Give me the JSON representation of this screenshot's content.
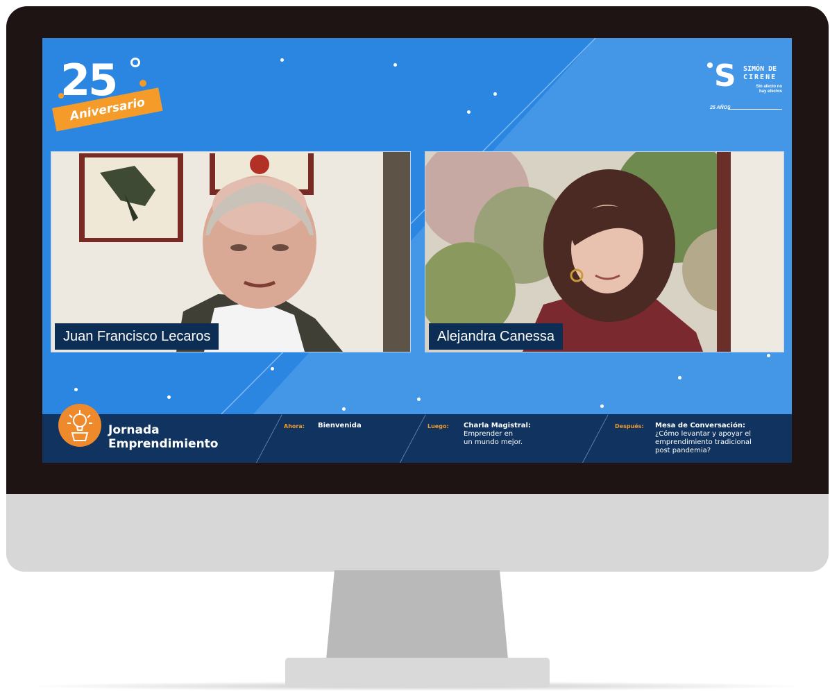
{
  "logo": {
    "number": "25",
    "ribbon": "Aniversario"
  },
  "brand": {
    "initial": "S",
    "name_line1": "SIMÓN DE",
    "name_line2": "CIRENE",
    "tagline_line1": "Sin afecto no",
    "tagline_line2": "hay efectos",
    "years": "25 AÑOS"
  },
  "participants": [
    {
      "name": "Juan Francisco Lecaros"
    },
    {
      "name": "Alejandra Canessa"
    }
  ],
  "event": {
    "title_line1": "Jornada",
    "title_line2": "Emprendimiento"
  },
  "schedule": {
    "now_label": "Ahora:",
    "now_value": "Bienvenida",
    "next_label": "Luego:",
    "next_title": "Charla Magistral:",
    "next_line1": "Emprender en",
    "next_line2": "un mundo mejor.",
    "after_label": "Después:",
    "after_title": "Mesa de Conversación:",
    "after_line1": "¿Cómo levantar y apoyar el",
    "after_line2": "emprendimiento tradicional",
    "after_line3": "post pandemia?"
  },
  "colors": {
    "screen_bg": "#2a86e0",
    "bar_bg": "#10345f",
    "accent_orange": "#f39a2b",
    "nametag_bg": "#0d2e54"
  },
  "icons": [
    "lightbulb-plant-icon"
  ]
}
